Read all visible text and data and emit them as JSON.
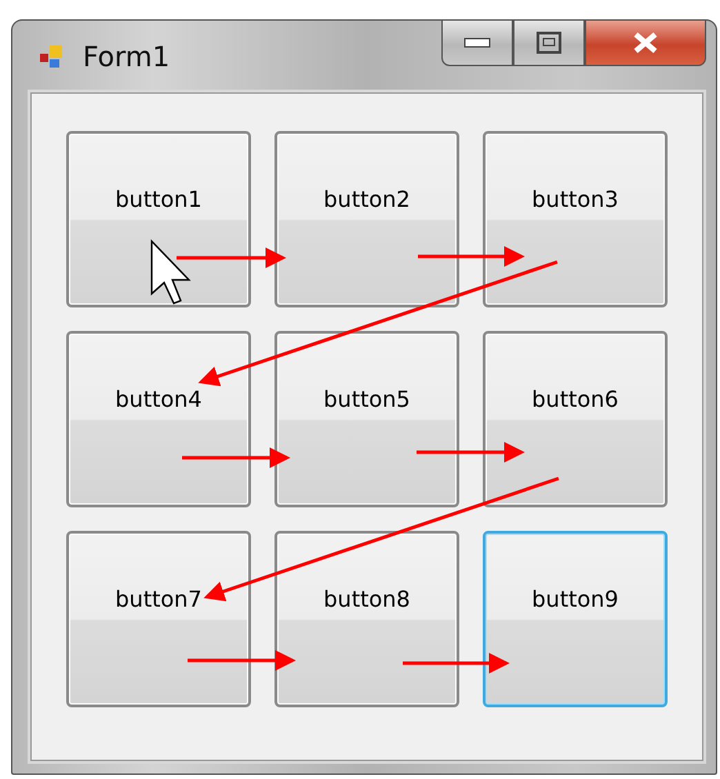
{
  "window": {
    "title": "Form1"
  },
  "buttons": [
    {
      "label": "button1",
      "focused": false
    },
    {
      "label": "button2",
      "focused": false
    },
    {
      "label": "button3",
      "focused": false
    },
    {
      "label": "button4",
      "focused": false
    },
    {
      "label": "button5",
      "focused": false
    },
    {
      "label": "button6",
      "focused": false
    },
    {
      "label": "button7",
      "focused": false
    },
    {
      "label": "button8",
      "focused": false
    },
    {
      "label": "button9",
      "focused": true
    }
  ]
}
